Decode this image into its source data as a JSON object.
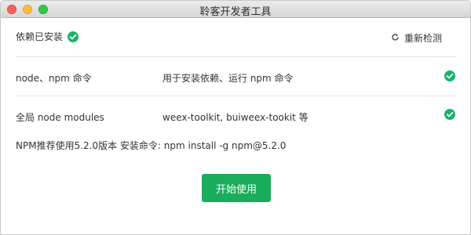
{
  "window": {
    "title": "聆客开发者工具"
  },
  "header": {
    "label": "依赖已安装",
    "recheck_label": "重新检测"
  },
  "rows": [
    {
      "name": "node、npm 命令",
      "desc": "用于安装依赖、运行 npm 命令",
      "status": "ok"
    },
    {
      "name": "全局 node modules",
      "desc": "weex-toolkit, buiweex-tookit 等",
      "status": "ok"
    }
  ],
  "npm_note": "NPM推荐使用5.2.0版本 安装命令: npm install -g npm@5.2.0",
  "start_button": "开始使用",
  "colors": {
    "accent": "#1aad5e",
    "check": "#17b36a"
  }
}
